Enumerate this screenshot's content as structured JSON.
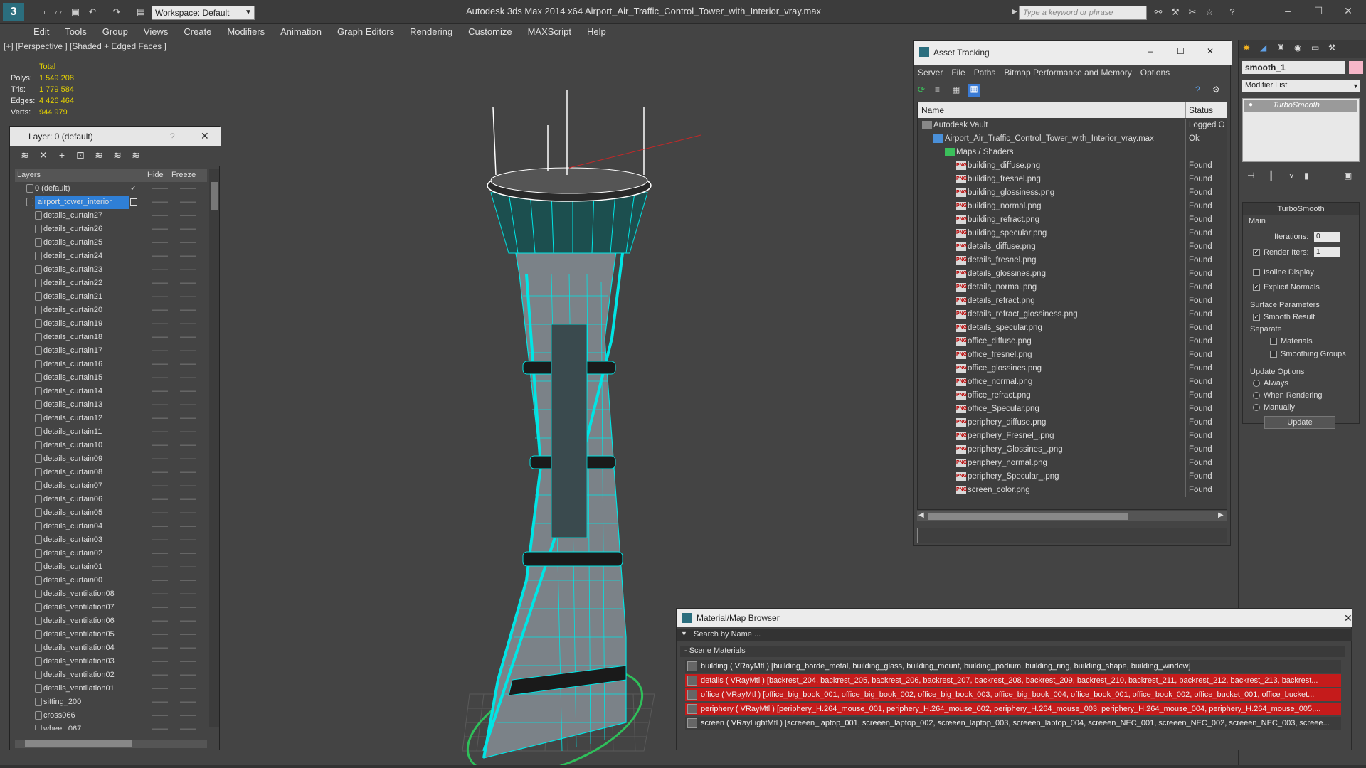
{
  "titlebar": {
    "app_logo": "3",
    "workspace": "Workspace: Default",
    "app_title": "Autodesk 3ds Max  2014 x64     Airport_Air_Traffic_Control_Tower_with_Interior_vray.max",
    "search_placeholder": "Type a keyword or phrase"
  },
  "menu": [
    "Edit",
    "Tools",
    "Group",
    "Views",
    "Create",
    "Modifiers",
    "Animation",
    "Graph Editors",
    "Rendering",
    "Customize",
    "MAXScript",
    "Help"
  ],
  "viewport": {
    "label": "[+] [Perspective ] [Shaded + Edged Faces ]",
    "stats_header": "Total",
    "stats": [
      {
        "label": "Polys:",
        "value": "1 549 208"
      },
      {
        "label": "Tris:",
        "value": "1 779 584"
      },
      {
        "label": "Edges:",
        "value": "4 426 464"
      },
      {
        "label": "Verts:",
        "value": "944 979"
      }
    ]
  },
  "layer_panel": {
    "title": "Layer: 0 (default)",
    "help": "?",
    "columns": {
      "layers": "Layers",
      "hide": "Hide",
      "freeze": "Freeze"
    },
    "rows": [
      "0 (default)",
      "airport_tower_interior",
      "details_curtain27",
      "details_curtain26",
      "details_curtain25",
      "details_curtain24",
      "details_curtain23",
      "details_curtain22",
      "details_curtain21",
      "details_curtain20",
      "details_curtain19",
      "details_curtain18",
      "details_curtain17",
      "details_curtain16",
      "details_curtain15",
      "details_curtain14",
      "details_curtain13",
      "details_curtain12",
      "details_curtain11",
      "details_curtain10",
      "details_curtain09",
      "details_curtain08",
      "details_curtain07",
      "details_curtain06",
      "details_curtain05",
      "details_curtain04",
      "details_curtain03",
      "details_curtain02",
      "details_curtain01",
      "details_curtain00",
      "details_ventilation08",
      "details_ventilation07",
      "details_ventilation06",
      "details_ventilation05",
      "details_ventilation04",
      "details_ventilation03",
      "details_ventilation02",
      "details_ventilation01",
      "sitting_200",
      "cross066",
      "wheel_067"
    ]
  },
  "asset_panel": {
    "title": "Asset Tracking",
    "menu": [
      "Server",
      "File",
      "Paths",
      "Bitmap Performance and Memory",
      "Options"
    ],
    "columns": {
      "name": "Name",
      "status": "Status"
    },
    "rows": [
      {
        "name": "Autodesk Vault",
        "status": "Logged O",
        "indent": 1
      },
      {
        "name": "Airport_Air_Traffic_Control_Tower_with_Interior_vray.max",
        "status": "Ok",
        "indent": 2
      },
      {
        "name": "Maps / Shaders",
        "status": "",
        "indent": 3
      },
      {
        "name": "building_diffuse.png",
        "status": "Found",
        "indent": 4
      },
      {
        "name": "building_fresnel.png",
        "status": "Found",
        "indent": 4
      },
      {
        "name": "building_glossiness.png",
        "status": "Found",
        "indent": 4
      },
      {
        "name": "building_normal.png",
        "status": "Found",
        "indent": 4
      },
      {
        "name": "building_refract.png",
        "status": "Found",
        "indent": 4
      },
      {
        "name": "building_specular.png",
        "status": "Found",
        "indent": 4
      },
      {
        "name": "details_diffuse.png",
        "status": "Found",
        "indent": 4
      },
      {
        "name": "details_fresnel.png",
        "status": "Found",
        "indent": 4
      },
      {
        "name": "details_glossines.png",
        "status": "Found",
        "indent": 4
      },
      {
        "name": "details_normal.png",
        "status": "Found",
        "indent": 4
      },
      {
        "name": "details_refract.png",
        "status": "Found",
        "indent": 4
      },
      {
        "name": "details_refract_glossiness.png",
        "status": "Found",
        "indent": 4
      },
      {
        "name": "details_specular.png",
        "status": "Found",
        "indent": 4
      },
      {
        "name": "office_diffuse.png",
        "status": "Found",
        "indent": 4
      },
      {
        "name": "office_fresnel.png",
        "status": "Found",
        "indent": 4
      },
      {
        "name": "office_glossines.png",
        "status": "Found",
        "indent": 4
      },
      {
        "name": "office_normal.png",
        "status": "Found",
        "indent": 4
      },
      {
        "name": "office_refract.png",
        "status": "Found",
        "indent": 4
      },
      {
        "name": "office_Specular.png",
        "status": "Found",
        "indent": 4
      },
      {
        "name": "periphery_diffuse.png",
        "status": "Found",
        "indent": 4
      },
      {
        "name": "periphery_Fresnel_.png",
        "status": "Found",
        "indent": 4
      },
      {
        "name": "periphery_Glossines_.png",
        "status": "Found",
        "indent": 4
      },
      {
        "name": "periphery_normal.png",
        "status": "Found",
        "indent": 4
      },
      {
        "name": "periphery_Specular_.png",
        "status": "Found",
        "indent": 4
      },
      {
        "name": "screen_color.png",
        "status": "Found",
        "indent": 4
      }
    ]
  },
  "command_panel": {
    "object_name": "smooth_1",
    "modifier_list": "Modifier List",
    "stack_item": "TurboSmooth",
    "rollout_title": "TurboSmooth",
    "main": "Main",
    "iterations_label": "Iterations:",
    "iterations": "0",
    "render_iters_label": "Render Iters:",
    "render_iters": "1",
    "isoline": "Isoline Display",
    "explicit_normals": "Explicit Normals",
    "surface_params": "Surface Parameters",
    "smooth_result": "Smooth Result",
    "separate": "Separate",
    "materials": "Materials",
    "smoothing_groups": "Smoothing Groups",
    "update_options": "Update Options",
    "always": "Always",
    "when_rendering": "When Rendering",
    "manually": "Manually",
    "update_button": "Update"
  },
  "material_browser": {
    "title": "Material/Map Browser",
    "search": "Search by Name ...",
    "section": "- Scene Materials",
    "rows": [
      {
        "text": "building  ( VRayMtl )  [building_borde_metal, building_glass, building_mount, building_podium, building_ring, building_shape, building_window]",
        "highlight": false
      },
      {
        "text": "details  ( VRayMtl )  [backrest_204, backrest_205, backrest_206, backrest_207, backrest_208, backrest_209, backrest_210, backrest_211, backrest_212, backrest_213, backrest...",
        "highlight": true
      },
      {
        "text": "office  ( VRayMtl )  [office_big_book_001, office_big_book_002, office_big_book_003, office_big_book_004, office_book_001, office_book_002, office_bucket_001, office_bucket...",
        "highlight": true
      },
      {
        "text": "periphery  ( VRayMtl )  [periphery_H.264_mouse_001, periphery_H.264_mouse_002, periphery_H.264_mouse_003, periphery_H.264_mouse_004, periphery_H.264_mouse_005,...",
        "highlight": true
      },
      {
        "text": "screen  ( VRayLightMtl )  [screeen_laptop_001, screeen_laptop_002, screeen_laptop_003, screeen_laptop_004, screeen_NEC_001, screeen_NEC_002, screeen_NEC_003, screee...",
        "highlight": false
      }
    ]
  },
  "colors": {
    "selected_layer": "#2f7fd6",
    "mat_highlight": "#c51b1b",
    "wire": "#00e5e5",
    "stats_value": "#e6d200"
  }
}
